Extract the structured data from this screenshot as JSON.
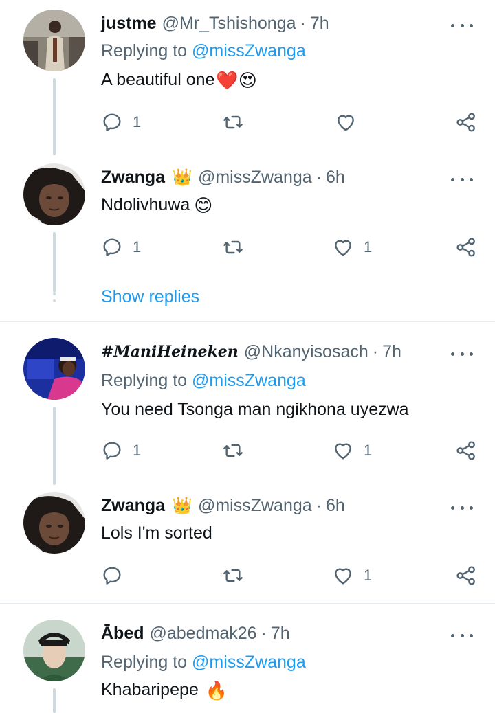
{
  "tweets": [
    {
      "name": "justme",
      "handle": "@Mr_Tshishonga",
      "separator": "·",
      "time": "7h",
      "replying_prefix": "Replying to ",
      "replying_to": "@missZwanga",
      "text": "A beautiful one",
      "emojis": "❤️😍",
      "reply_count": "1",
      "retweet_count": "",
      "like_count": ""
    },
    {
      "name": "Zwanga",
      "crown": "👑",
      "handle": "@missZwanga",
      "separator": "·",
      "time": "6h",
      "text": "Ndolivhuwa",
      "emojis": "😊",
      "reply_count": "1",
      "retweet_count": "",
      "like_count": "1"
    },
    {
      "name": "#ManiHeineken",
      "handle": "@Nkanyisosach",
      "separator": "·",
      "time": "7h",
      "replying_prefix": "Replying to ",
      "replying_to": "@missZwanga",
      "text": "You need Tsonga man ngikhona uyezwa",
      "reply_count": "1",
      "retweet_count": "",
      "like_count": "1"
    },
    {
      "name": "Zwanga",
      "crown": "👑",
      "handle": "@missZwanga",
      "separator": "·",
      "time": "6h",
      "text": "Lols I'm sorted",
      "reply_count": "",
      "retweet_count": "",
      "like_count": "1"
    },
    {
      "name": "Ābed",
      "handle": "@abedmak26",
      "separator": "·",
      "time": "7h",
      "replying_prefix": "Replying to ",
      "replying_to": "@missZwanga",
      "text": "Khabaripepe",
      "emojis": "🔥"
    }
  ],
  "show_replies": "Show replies",
  "colors": {
    "link": "#1d9bf0",
    "secondary": "#536471",
    "thread_line": "#cfd9de",
    "divider": "#e6ecf0"
  },
  "icons": [
    "reply-icon",
    "retweet-icon",
    "like-icon",
    "share-icon",
    "more-icon"
  ]
}
